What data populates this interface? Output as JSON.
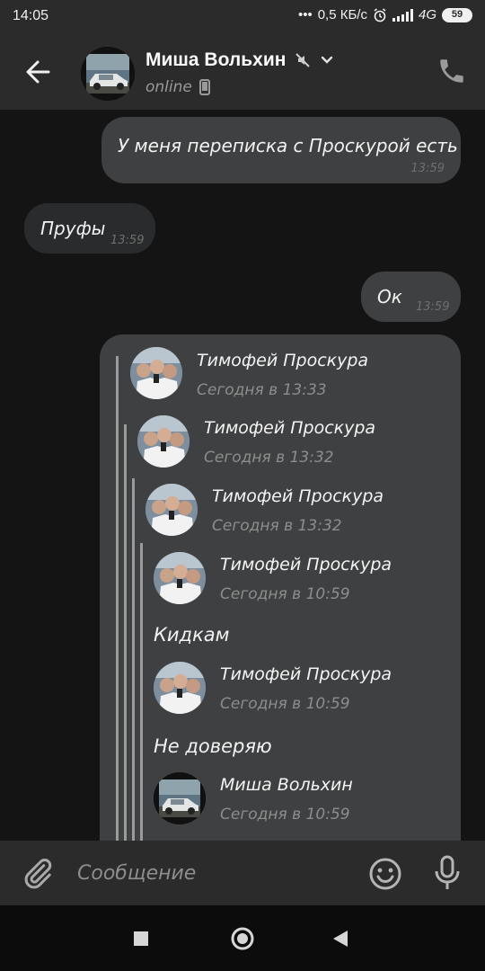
{
  "status_bar": {
    "time": "14:05",
    "speed": "0,5 КБ/с",
    "network": "4G",
    "battery": "59"
  },
  "header": {
    "contact_name": "Миша Вольхин",
    "status": "online",
    "icons": [
      "back-arrow-icon",
      "mute-icon",
      "chevron-down-icon",
      "mobile-device-icon",
      "phone-icon"
    ]
  },
  "messages": [
    {
      "direction": "out",
      "text": "У меня переписка с Проскурой есть",
      "time": "13:59"
    },
    {
      "direction": "in",
      "text": "Пруфы",
      "time": "13:59"
    },
    {
      "direction": "out",
      "text": "Ок",
      "time": "13:59"
    }
  ],
  "forwarded": {
    "entries": [
      {
        "name": "Тимофей Проскура",
        "date": "Сегодня в 13:33"
      },
      {
        "name": "Тимофей Проскура",
        "date": "Сегодня в 13:32"
      },
      {
        "name": "Тимофей Проскура",
        "date": "Сегодня в 13:32"
      },
      {
        "name": "Тимофей Проскура",
        "date": "Сегодня в 10:59",
        "text": "Кидкам"
      },
      {
        "name": "Тимофей Проскура",
        "date": "Сегодня в 10:59",
        "text": "Не доверяю"
      },
      {
        "name": "Миша Вольхин",
        "date": "Сегодня в 10:59"
      }
    ]
  },
  "composer": {
    "placeholder": "Сообщение",
    "icons": [
      "attach-icon",
      "emoji-icon",
      "microphone-icon"
    ]
  },
  "navigation": {
    "icons": [
      "recents-square-icon",
      "home-circle-icon",
      "back-triangle-icon"
    ]
  },
  "colors": {
    "background": "#141414",
    "bar": "#2b2b2b",
    "bubble_out": "#3f4041",
    "bubble_in": "#2a2b2c",
    "time_text": "#6f6f6f"
  }
}
